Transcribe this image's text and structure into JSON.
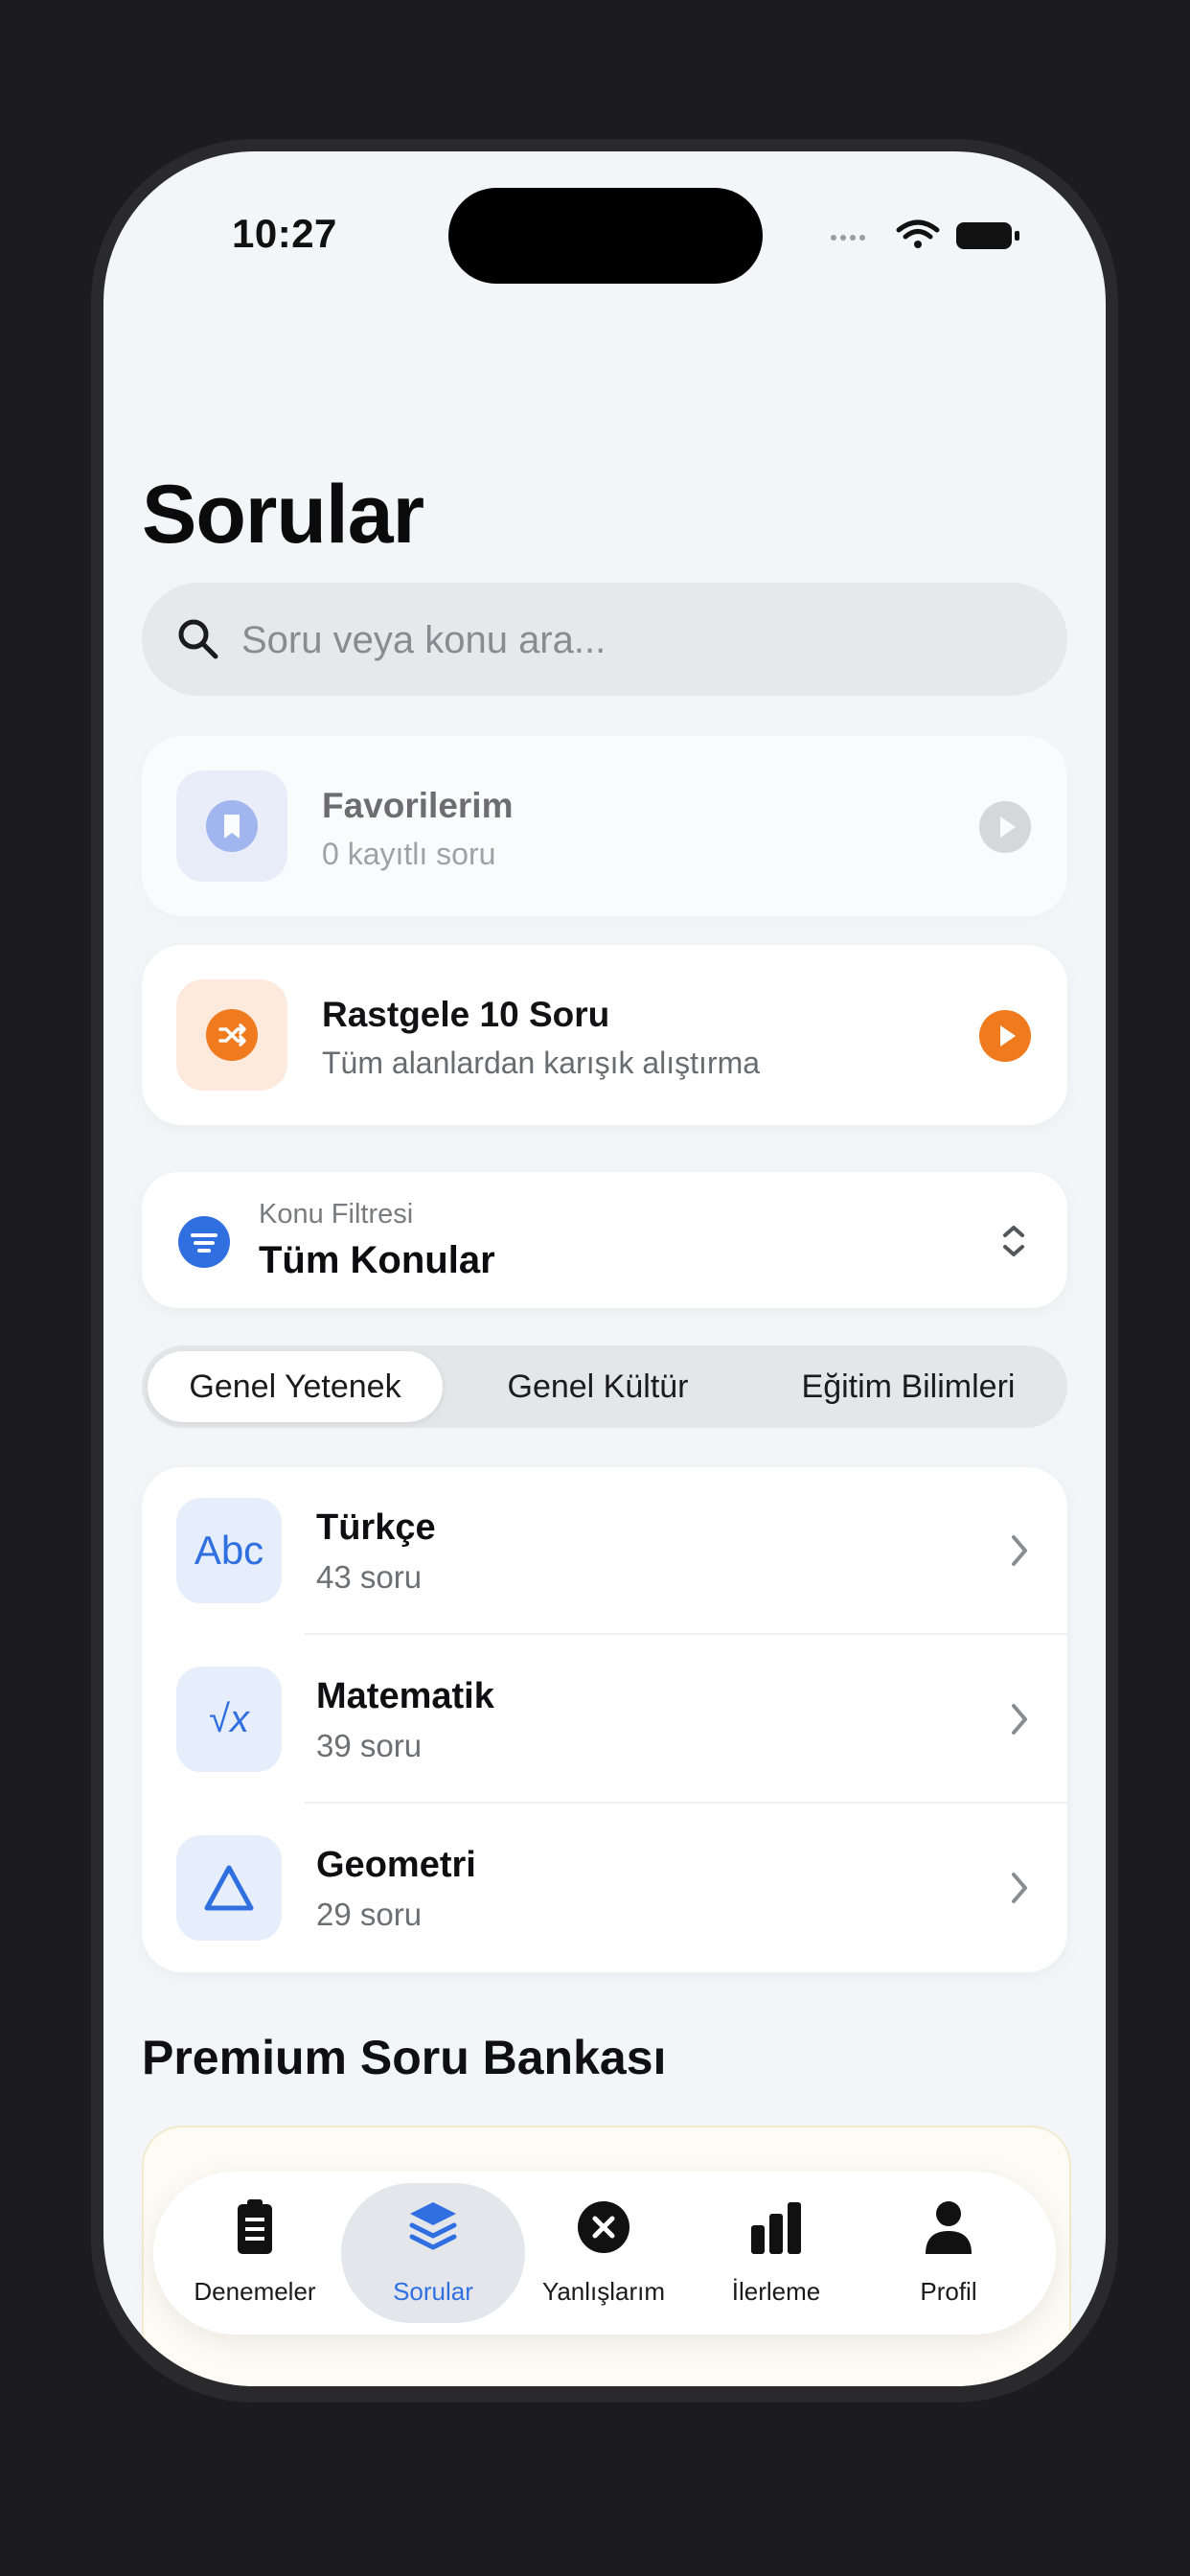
{
  "status_bar": {
    "time": "10:27"
  },
  "header": {
    "title": "Sorular"
  },
  "search": {
    "placeholder": "Soru veya konu ara..."
  },
  "favorites": {
    "title": "Favorilerim",
    "subtitle": "0 kayıtlı soru"
  },
  "random": {
    "title": "Rastgele 10 Soru",
    "subtitle": "Tüm alanlardan karışık alıştırma"
  },
  "filter": {
    "caption": "Konu Filtresi",
    "value": "Tüm Konular"
  },
  "segments": [
    {
      "label": "Genel Yetenek",
      "active": true
    },
    {
      "label": "Genel Kültür",
      "active": false
    },
    {
      "label": "Eğitim Bilimleri",
      "active": false
    }
  ],
  "subjects": [
    {
      "icon": "abc-icon",
      "icon_text": "Abc",
      "name": "Türkçe",
      "count": "43 soru"
    },
    {
      "icon": "square-root-icon",
      "icon_text": "√x",
      "name": "Matematik",
      "count": "39 soru"
    },
    {
      "icon": "triangle-icon",
      "icon_text": "",
      "name": "Geometri",
      "count": "29 soru"
    }
  ],
  "premium": {
    "title": "Premium Soru Bankası"
  },
  "tabbar": [
    {
      "label": "Denemeler",
      "icon": "clipboard-icon",
      "active": false
    },
    {
      "label": "Sorular",
      "icon": "stack-icon",
      "active": true
    },
    {
      "label": "Yanlışlarım",
      "icon": "x-circle-icon",
      "active": false
    },
    {
      "label": "İlerleme",
      "icon": "bar-chart-icon",
      "active": false
    },
    {
      "label": "Profil",
      "icon": "person-icon",
      "active": false
    }
  ],
  "colors": {
    "accent_blue": "#2f6fe0",
    "accent_orange": "#f07a1e",
    "favorites_icon": "#6f8fe8",
    "background": "#f4f5f8"
  }
}
